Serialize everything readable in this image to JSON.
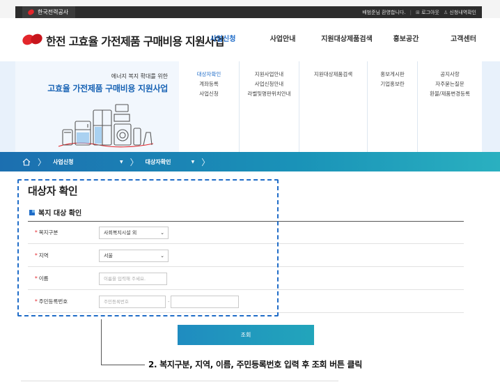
{
  "topbar": {
    "org_name": "한국전력공사",
    "greeting": "배범준님 환영합니다.",
    "logout": "로그아웃",
    "my_apply": "신청내역확인"
  },
  "header": {
    "site_title": "한전 고효율 가전제품 구매비용 지원사업",
    "gnb": [
      "사업신청",
      "사업안내",
      "지원대상제품검색",
      "홍보공간",
      "고객센터"
    ],
    "active_gnb": "사업신청"
  },
  "mega_menu": {
    "visual_subtitle": "에너지 복지 확대를 위한",
    "visual_title": "고효율 가전제품 구매비용 지원사업",
    "columns": [
      [
        "대상자확인",
        "계좌등록",
        "사업신청"
      ],
      [
        "지원사업안내",
        "사업신청안내",
        "라벨및명판위치안내"
      ],
      [
        "지원대상제품검색"
      ],
      [
        "홍보게시판",
        "기업홍보란"
      ],
      [
        "공지사항",
        "자주묻는질문",
        "환불/제품변경등록"
      ]
    ]
  },
  "breadcrumb": {
    "level1": "사업신청",
    "level2": "대상자확인"
  },
  "content": {
    "page_title": "대상자 확인",
    "section_title": "복지 대상 확인",
    "fields": {
      "welfare_type": {
        "label": "복지구분",
        "value": "사회복지시설 외"
      },
      "region": {
        "label": "지역",
        "value": "서울"
      },
      "name": {
        "label": "이름",
        "placeholder": "이름을 입력해 주세요."
      },
      "rrn": {
        "label": "주민등록번호",
        "placeholder": "주민등록번호"
      }
    },
    "required_mark": "*",
    "search_button": "조회"
  },
  "annotation": {
    "callout": "2. 복지구분, 지역, 이름, 주민등록번호 입력 후 조회 버튼 클릭",
    "highlight_color": "#1f6cc8"
  }
}
